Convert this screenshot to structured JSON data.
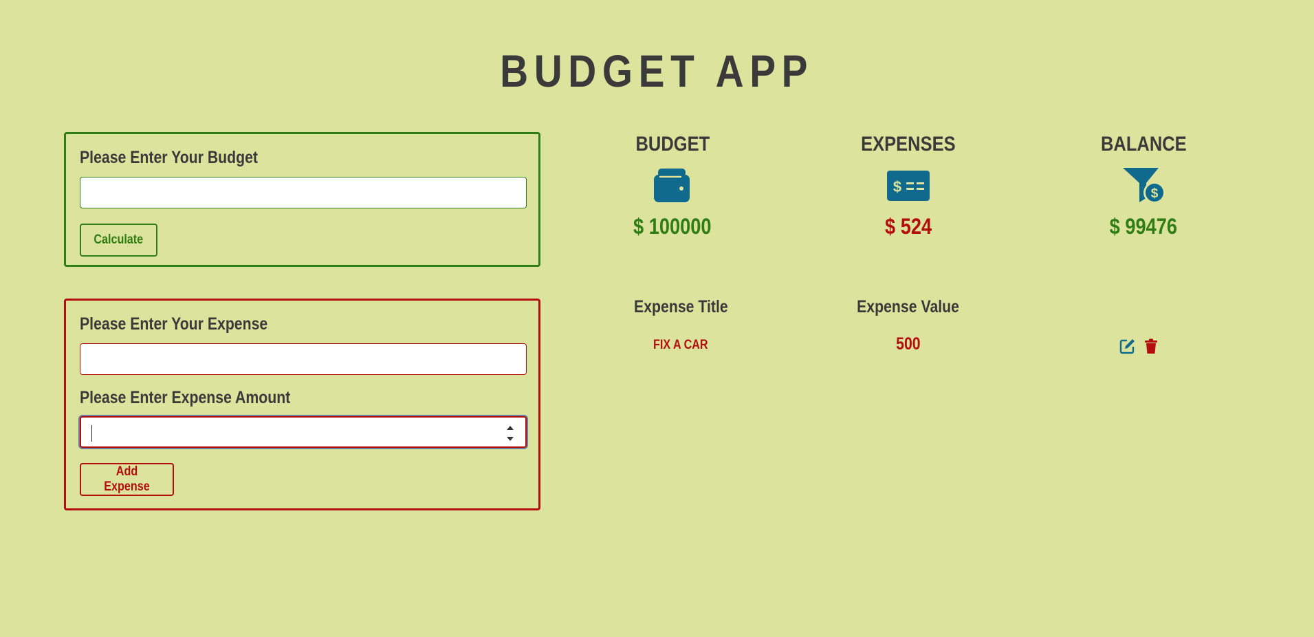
{
  "app": {
    "title": "BUDGET APP"
  },
  "colors": {
    "background": "#dce39c",
    "primary_text": "#3a3a3a",
    "green_accent": "#2f7d14",
    "red_accent": "#b30e0e",
    "icon_blue": "#0f6a8e"
  },
  "budget_form": {
    "label": "Please Enter Your Budget",
    "value": "",
    "placeholder": "",
    "button_label": "Calculate"
  },
  "expense_form": {
    "title_label": "Please Enter Your Expense",
    "title_value": "",
    "amount_label": "Please Enter Expense Amount",
    "amount_value": "",
    "button_label": "Add Expense"
  },
  "summary": {
    "budget": {
      "heading": "BUDGET",
      "icon": "wallet-icon",
      "amount": "$ 100000"
    },
    "expenses": {
      "heading": "EXPENSES",
      "icon": "money-check-icon",
      "amount": "$ 524"
    },
    "balance": {
      "heading": "BALANCE",
      "icon": "funnel-dollar-icon",
      "amount": "$ 99476"
    }
  },
  "expense_list": {
    "headers": {
      "title": "Expense Title",
      "value": "Expense Value"
    },
    "items": [
      {
        "title": "FIX A CAR",
        "value": "500",
        "actions": [
          "edit-icon",
          "trash-icon"
        ]
      }
    ]
  }
}
